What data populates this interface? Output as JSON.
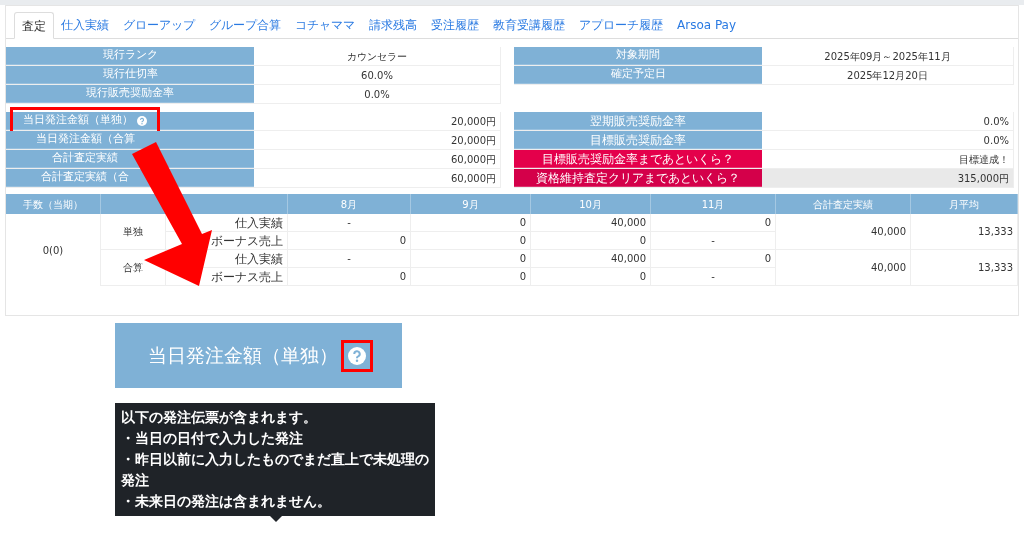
{
  "tabs": [
    {
      "label": "査定",
      "selected": true
    },
    {
      "label": "仕入実績",
      "selected": false
    },
    {
      "label": "グローアップ",
      "selected": false
    },
    {
      "label": "グループ合算",
      "selected": false
    },
    {
      "label": "コチャママ",
      "selected": false
    },
    {
      "label": "請求残高",
      "selected": false
    },
    {
      "label": "受注履歴",
      "selected": false
    },
    {
      "label": "教育受講履歴",
      "selected": false
    },
    {
      "label": "アプローチ履歴",
      "selected": false
    },
    {
      "label": "Arsoa Pay",
      "selected": false
    }
  ],
  "summary_left": [
    {
      "label": "現行ランク",
      "value": "カウンセラー"
    },
    {
      "label": "現行仕切率",
      "value": "60.0%"
    },
    {
      "label": "現行販売奨励金率",
      "value": "0.0%"
    }
  ],
  "summary_right": [
    {
      "label": "対象期間",
      "value": "2025年09月～2025年11月"
    },
    {
      "label": "確定予定日",
      "value": "2025年12月20日"
    }
  ],
  "detail_left": [
    {
      "label": "当日発注金額（単独）",
      "value": "20,000円",
      "help": true,
      "highlighted": true
    },
    {
      "label": "当日発注金額（合算",
      "value": "20,000円",
      "help": false,
      "highlighted": false
    },
    {
      "label": "合計査定実績",
      "value": "60,000円",
      "help": false,
      "highlighted": false
    },
    {
      "label": "合計査定実績（合",
      "value": "60,000円",
      "help": false,
      "highlighted": false
    }
  ],
  "detail_right": [
    {
      "label": "翌期販売奨励金率",
      "value": "0.0%",
      "kind": "normal"
    },
    {
      "label": "目標販売奨励金率",
      "value": "0.0%",
      "kind": "normal"
    },
    {
      "label": "目標販売奨励金率まであといくら？",
      "value": "目標達成！",
      "kind": "alert"
    },
    {
      "label": "資格維持査定クリアまであといくら？",
      "value": "315,000円",
      "kind": "alert_dark"
    }
  ],
  "table": {
    "columns": [
      "手数（当期）",
      "8月",
      "9月",
      "10月",
      "11月",
      "合計査定実績",
      "月平均"
    ],
    "count": "0(0)",
    "groups": [
      {
        "name": "単独",
        "total": "40,000",
        "average": "13,333",
        "rows": [
          {
            "item": "仕入実績",
            "values": [
              "-",
              "0",
              "40,000",
              "0"
            ]
          },
          {
            "item": "ボーナス売上",
            "values": [
              "0",
              "0",
              "0",
              "-"
            ]
          }
        ]
      },
      {
        "name": "合算",
        "total": "40,000",
        "average": "13,333",
        "rows": [
          {
            "item": "仕入実績",
            "values": [
              "-",
              "0",
              "40,000",
              "0"
            ]
          },
          {
            "item": "ボーナス売上",
            "values": [
              "0",
              "0",
              "0",
              "-"
            ]
          }
        ]
      }
    ]
  },
  "callout": {
    "label": "当日発注金額（単独）",
    "help": true,
    "tooltip": [
      "以下の発注伝票が含まれます。",
      "・当日の日付で入力した発注",
      "・昨日以前に入力したものでまだ直上で未処理の発注",
      "・未来日の発注は含まれません。"
    ]
  }
}
